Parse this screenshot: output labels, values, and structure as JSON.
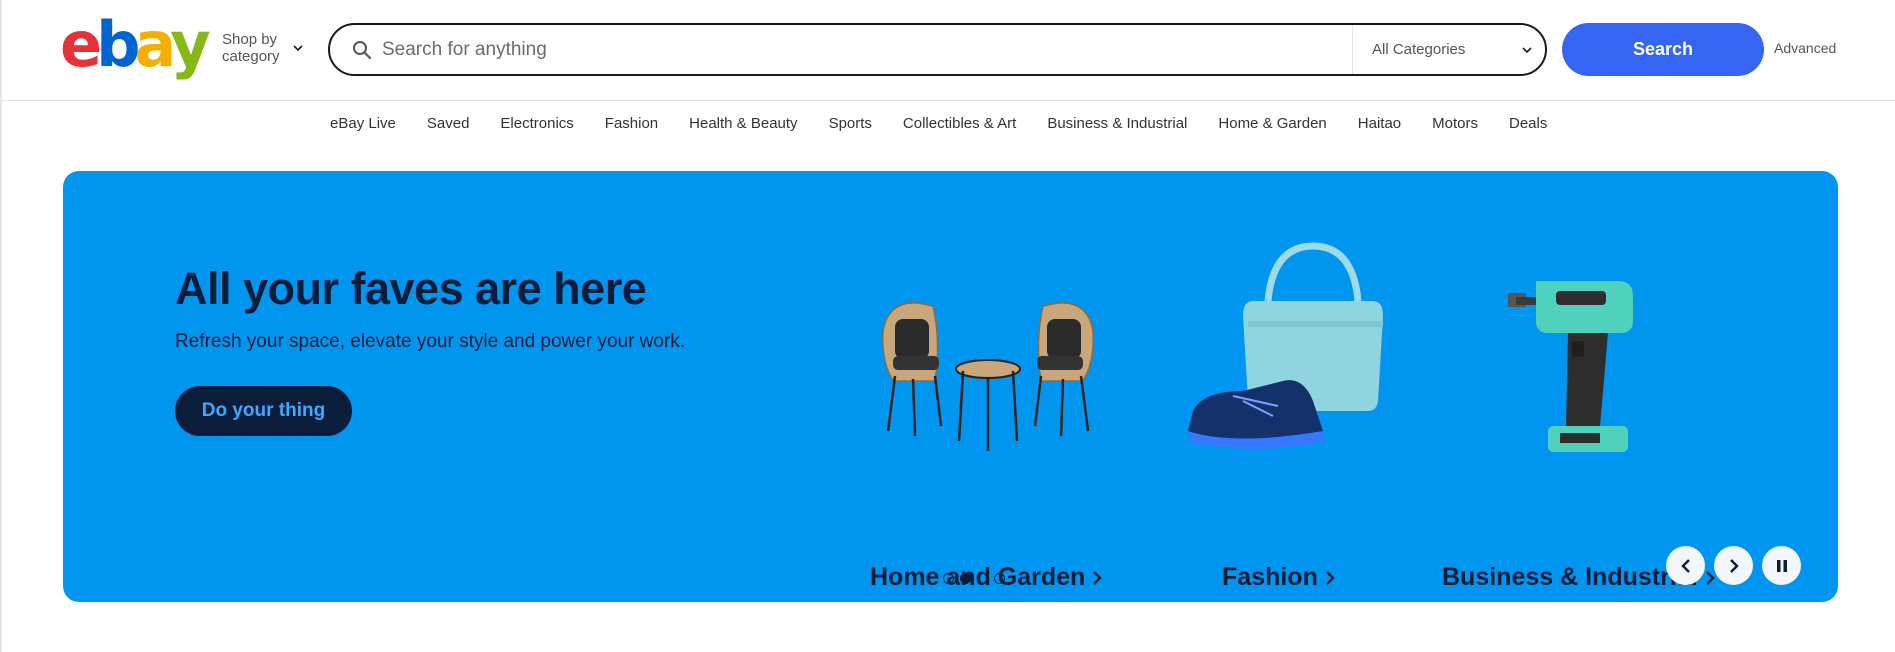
{
  "logo": {
    "letters": [
      "e",
      "b",
      "a",
      "y"
    ],
    "colors": [
      "#e53238",
      "#0064d2",
      "#f5af02",
      "#86b817"
    ]
  },
  "shop_by": {
    "label": "Shop by category",
    "icon": "chevron-down-icon"
  },
  "search": {
    "placeholder": "Search for anything",
    "value": "",
    "category": "All Categories",
    "button_label": "Search",
    "advanced_label": "Advanced",
    "icon": "search-icon",
    "button_color": "#3665f3"
  },
  "nav": {
    "items": [
      "eBay Live",
      "Saved",
      "Electronics",
      "Fashion",
      "Health & Beauty",
      "Sports",
      "Collectibles & Art",
      "Business & Industrial",
      "Home & Garden",
      "Haitao",
      "Motors",
      "Deals"
    ]
  },
  "hero": {
    "background": "#0096ef",
    "title": "All your faves are here",
    "subtitle": "Refresh your space, elevate your style and power your work.",
    "cta_label": "Do your thing",
    "tiles": [
      {
        "label": "Home and Garden",
        "image": "patio-chairs-table"
      },
      {
        "label": "Fashion",
        "image": "handbag-sneaker"
      },
      {
        "label": "Business & Industrial",
        "image": "power-drill"
      }
    ],
    "carousel": {
      "slides": 4,
      "active_index": 1
    },
    "controls": [
      "previous-icon",
      "next-icon",
      "pause-icon"
    ]
  }
}
